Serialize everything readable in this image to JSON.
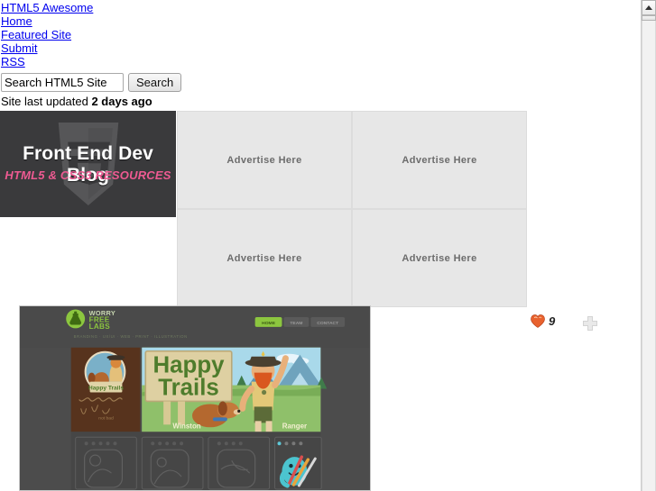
{
  "site": {
    "title": "HTML5 Awesome"
  },
  "nav": {
    "items": [
      {
        "label": "HTML5 Awesome",
        "name": "nav-link-html5-awesome"
      },
      {
        "label": "Home",
        "name": "nav-link-home"
      },
      {
        "label": "Featured Site",
        "name": "nav-link-featured-site"
      },
      {
        "label": "Submit",
        "name": "nav-link-submit"
      },
      {
        "label": "RSS",
        "name": "nav-link-rss"
      }
    ]
  },
  "search": {
    "value": "Search HTML5 Site",
    "placeholder": "Search HTML5 Site",
    "button_label": "Search"
  },
  "status": {
    "updated_prefix": "Site last updated ",
    "updated_value": "2 days ago"
  },
  "banner": {
    "title": "Front End Dev Blog",
    "subtitle": "HTML5 & CSS3 RESOURCES",
    "bg_color": "#3a3a3c",
    "title_color": "#ffffff",
    "subtitle_color": "#ee5a92",
    "watermark_icon": "html5-shield-icon"
  },
  "ads": {
    "slots": [
      {
        "label": "Advertise Here"
      },
      {
        "label": "Advertise Here"
      },
      {
        "label": "Advertise Here"
      },
      {
        "label": "Advertise Here"
      }
    ],
    "bg_color": "#e7e7e7",
    "text_color": "#6c6c6c"
  },
  "like_widget": {
    "heart_icon": "heart-icon",
    "count": "9",
    "add_icon": "plus-icon",
    "heart_color": "#e8622e"
  },
  "featured_thumb": {
    "site_name": "WORRY FREE LABS",
    "logo_word_1": "WORRY",
    "logo_word_2": "FREE",
    "logo_word_3": "LABS",
    "tagline": "BRANDING · UX/UI · WEB · PRINT · ILLUSTRATION",
    "nav": [
      {
        "label": "HOME",
        "active": true
      },
      {
        "label": "TEAM",
        "active": false
      },
      {
        "label": "CONTACT",
        "active": false
      }
    ],
    "hero_sign_line_1": "Happy",
    "hero_sign_line_2": "Trails",
    "hero_sign_small": "Happy Trails",
    "character_dog": "Winston",
    "character_ranger": "Ranger",
    "accent_green": "#8cc63f",
    "bg_color": "#4c4c4c"
  },
  "scrollbar": {
    "up_arrow_icon": "chevron-up-icon"
  }
}
